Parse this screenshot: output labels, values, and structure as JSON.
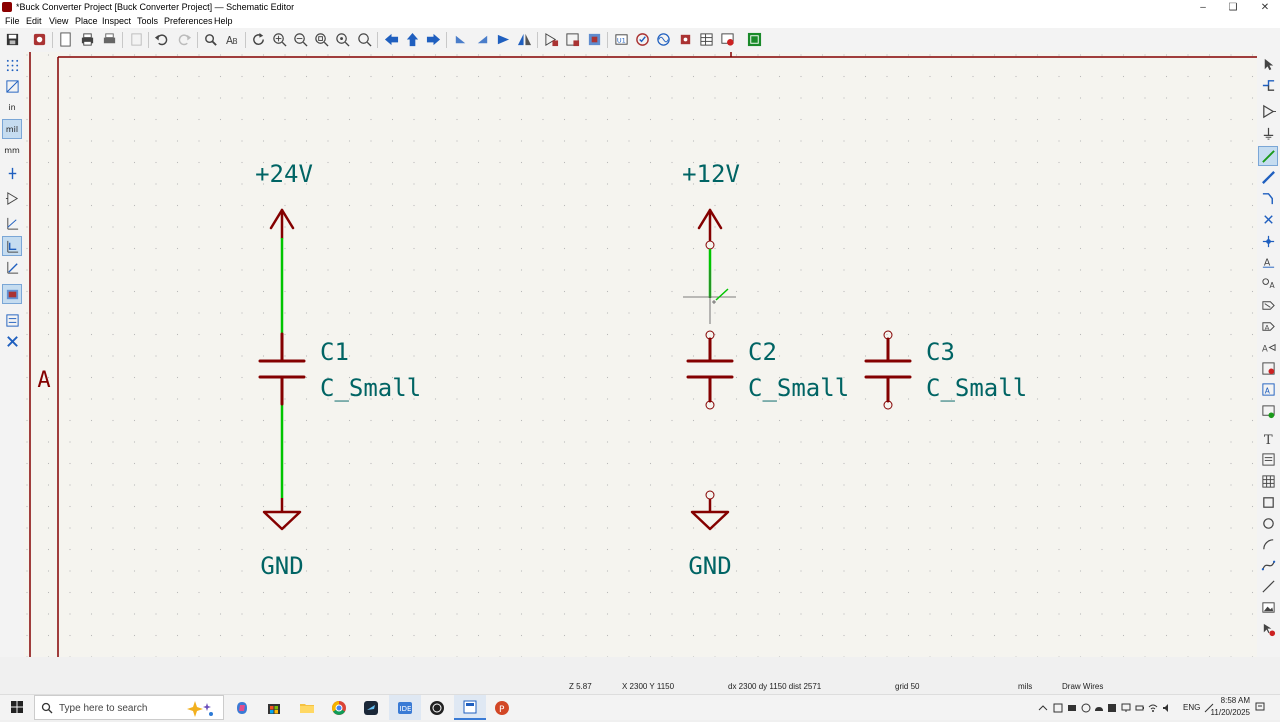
{
  "window": {
    "title": "*Buck Converter Project [Buck Converter Project] — Schematic Editor",
    "controls": [
      "minimize",
      "maximize",
      "close"
    ]
  },
  "menu": [
    "File",
    "Edit",
    "View",
    "Place",
    "Inspect",
    "Tools",
    "Preferences",
    "Help"
  ],
  "left_toolbar": {
    "unit_labels": [
      "in",
      "mil",
      "mm"
    ],
    "selected_unit": "mil"
  },
  "schematic": {
    "sheet_row_label": "A",
    "power_symbols": [
      "+24V",
      "+12V"
    ],
    "ground_labels": [
      "GND",
      "GND"
    ],
    "components": [
      {
        "ref": "C1",
        "value": "C_Small"
      },
      {
        "ref": "C2",
        "value": "C_Small"
      },
      {
        "ref": "C3",
        "value": "C_Small"
      }
    ],
    "colors": {
      "background": "#f5f4ef",
      "symbol": "#840000",
      "text": "#006464",
      "wire": "#00c400",
      "grid": "#b8b8b8"
    }
  },
  "status": {
    "zoom": "Z 5.87",
    "cursor": "X 2300  Y 1150",
    "delta": "dx 2300  dy 1150  dist 2571",
    "grid": "grid 50",
    "units": "mils",
    "mode": "Draw Wires"
  },
  "taskbar": {
    "search_placeholder": "Type here to search",
    "ide_label": "IDE",
    "language": "ENG",
    "time": "8:58 AM",
    "date": "11/20/2025"
  }
}
